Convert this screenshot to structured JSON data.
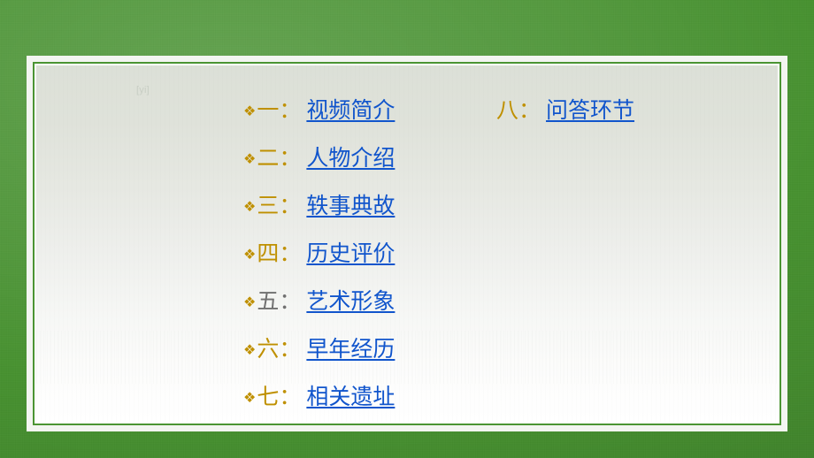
{
  "slide": {
    "background_color": "#479130",
    "frame_color": "#ffffff",
    "frame_line_color": "#4b9433",
    "panel_top_color": "#dce0d7",
    "panel_bottom_color": "#ffffff",
    "watermark_text": "[yi]"
  },
  "colors": {
    "numeral_gold": "#bf9000",
    "numeral_gray": "#707070",
    "link_blue": "#1155cc",
    "bullet_gold": "#bf9000"
  },
  "contents": {
    "left_column": [
      {
        "bullet": "diamond-bullet-icon",
        "numeral": "一",
        "colon": "：",
        "label": "视频简介",
        "numeral_color": "#bf9000"
      },
      {
        "bullet": "diamond-bullet-icon",
        "numeral": "二",
        "colon": "：",
        "label": "人物介绍",
        "numeral_color": "#bf9000"
      },
      {
        "bullet": "diamond-bullet-icon",
        "numeral": "三",
        "colon": "：",
        "label": "轶事典故",
        "numeral_color": "#bf9000"
      },
      {
        "bullet": "diamond-bullet-icon",
        "numeral": "四",
        "colon": "：",
        "label": "历史评价",
        "numeral_color": "#bf9000"
      },
      {
        "bullet": "diamond-bullet-icon",
        "numeral": "五",
        "colon": "：",
        "label": "艺术形象",
        "numeral_color": "#707070"
      },
      {
        "bullet": "diamond-bullet-icon",
        "numeral": "六",
        "colon": "：",
        "label": "早年经历",
        "numeral_color": "#bf9000"
      },
      {
        "bullet": "diamond-bullet-icon",
        "numeral": "七",
        "colon": "：",
        "label": "相关遗址",
        "numeral_color": "#bf9000"
      }
    ],
    "right_column": [
      {
        "bullet": "",
        "numeral": "八",
        "colon": "：",
        "label": "问答环节",
        "numeral_color": "#bf9000"
      }
    ]
  },
  "bullet_glyph": "❖"
}
